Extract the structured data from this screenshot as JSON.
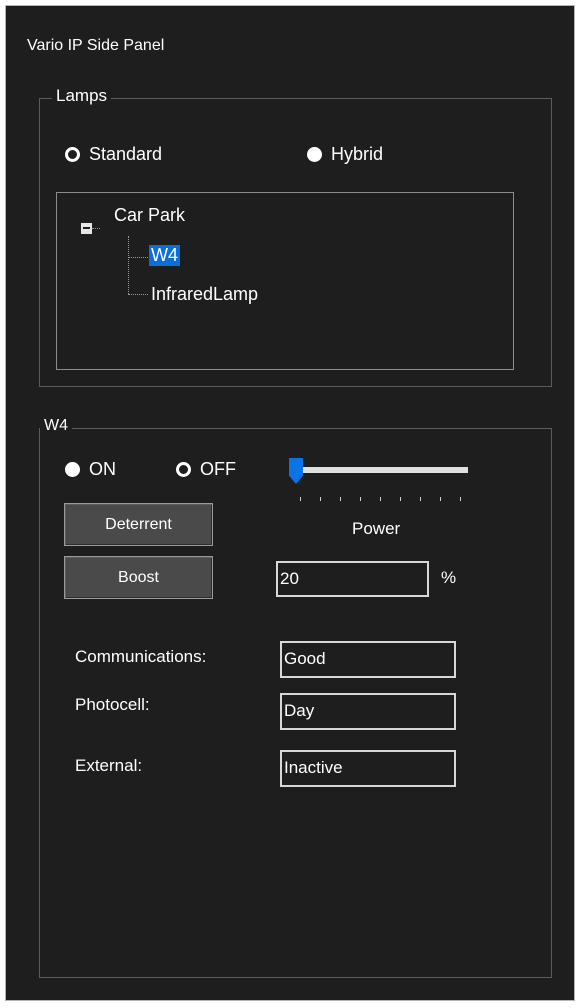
{
  "window": {
    "title": "Vario IP Side Panel"
  },
  "lamps": {
    "legend": "Lamps",
    "mode_options": [
      {
        "label": "Standard",
        "selected": false
      },
      {
        "label": "Hybrid",
        "selected": true
      }
    ],
    "tree": {
      "root": "Car Park",
      "children": [
        "W4",
        "InfraredLamp"
      ],
      "selected": "W4"
    }
  },
  "lamp": {
    "legend": "W4",
    "state_options": [
      {
        "label": "ON",
        "selected": true
      },
      {
        "label": "OFF",
        "selected": false
      }
    ],
    "deterrent_label": "Deterrent",
    "boost_label": "Boost",
    "power_label": "Power",
    "power_slider_level": 0,
    "percent_value": "20",
    "percent_unit": "%",
    "status": [
      {
        "label": "Communications:",
        "value": "Good"
      },
      {
        "label": "Photocell:",
        "value": "Day"
      },
      {
        "label": "External:",
        "value": "Inactive"
      }
    ]
  },
  "colors": {
    "background": "#1e1e1e",
    "accent": "#0a6fd6"
  }
}
